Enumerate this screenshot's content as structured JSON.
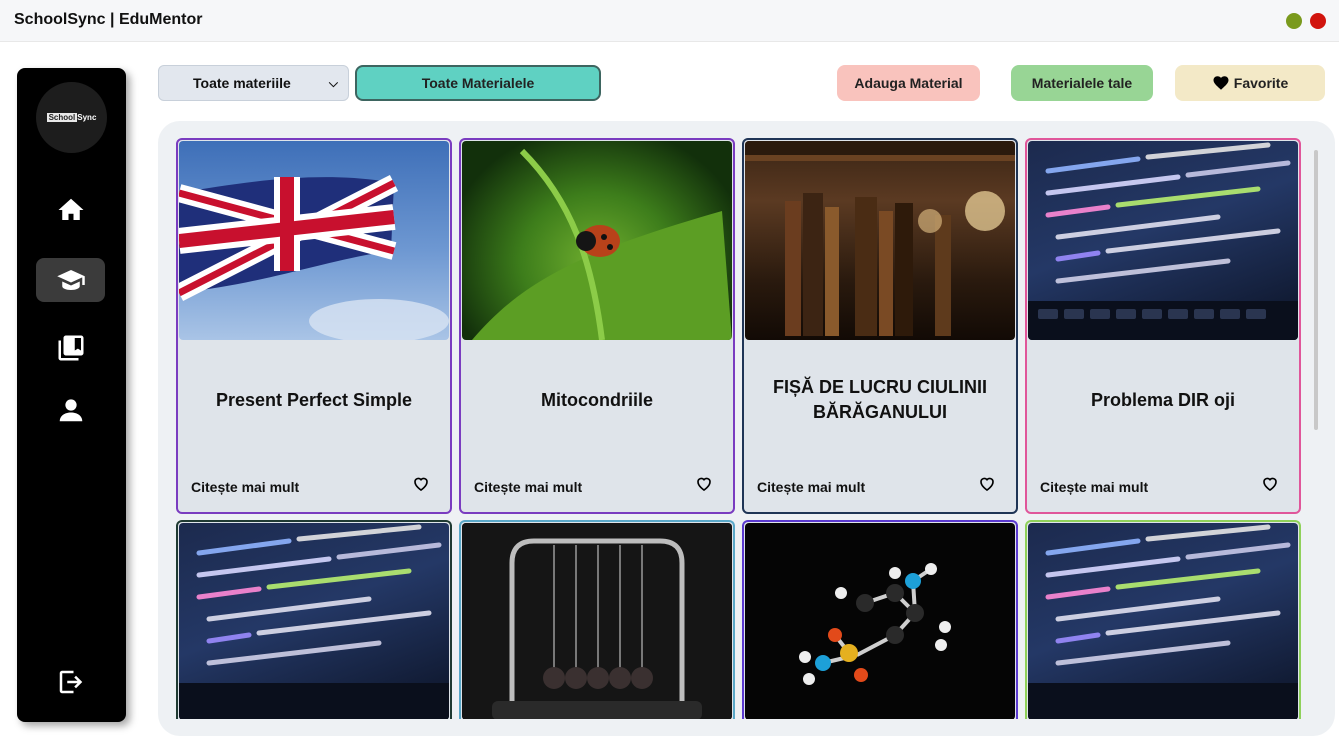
{
  "window": {
    "title": "SchoolSync | EduMentor"
  },
  "sidebar": {
    "logo_text_a": "School",
    "logo_text_b": "Sync",
    "items": [
      {
        "icon": "home-icon"
      },
      {
        "icon": "graduation-cap-icon",
        "active": true
      },
      {
        "icon": "book-icon"
      },
      {
        "icon": "user-icon"
      },
      {
        "icon": "logout-icon"
      }
    ]
  },
  "toolbar": {
    "subject_select": "Toate materiile",
    "all_materials": "Toate Materialele",
    "add_material": "Adauga Material",
    "my_materials": "Materialele tale",
    "favorites": "Favorite"
  },
  "cards": [
    {
      "title": "Present Perfect Simple",
      "read_more": "Citește mai mult",
      "image": "uk-flag",
      "border": "#7a3cc0"
    },
    {
      "title": "Mitocondriile",
      "read_more": "Citește mai mult",
      "image": "ladybug-leaf",
      "border": "#7a3cc0"
    },
    {
      "title": "FIȘĂ DE LUCRU CIULINII BĂRĂGANULUI",
      "read_more": "Citește mai mult",
      "image": "old-books",
      "border": "#1f3556"
    },
    {
      "title": "Problema DIR oji",
      "read_more": "Citește mai mult",
      "image": "code-screen",
      "border": "#e0569a"
    },
    {
      "title": "",
      "read_more": "",
      "image": "code-screen",
      "border": "#1f3a32"
    },
    {
      "title": "",
      "read_more": "",
      "image": "newtons-cradle",
      "border": "#5aa8c8"
    },
    {
      "title": "",
      "read_more": "",
      "image": "molecule-model",
      "border": "#5b3ad0"
    },
    {
      "title": "",
      "read_more": "",
      "image": "code-screen",
      "border": "#8fd15a"
    }
  ]
}
